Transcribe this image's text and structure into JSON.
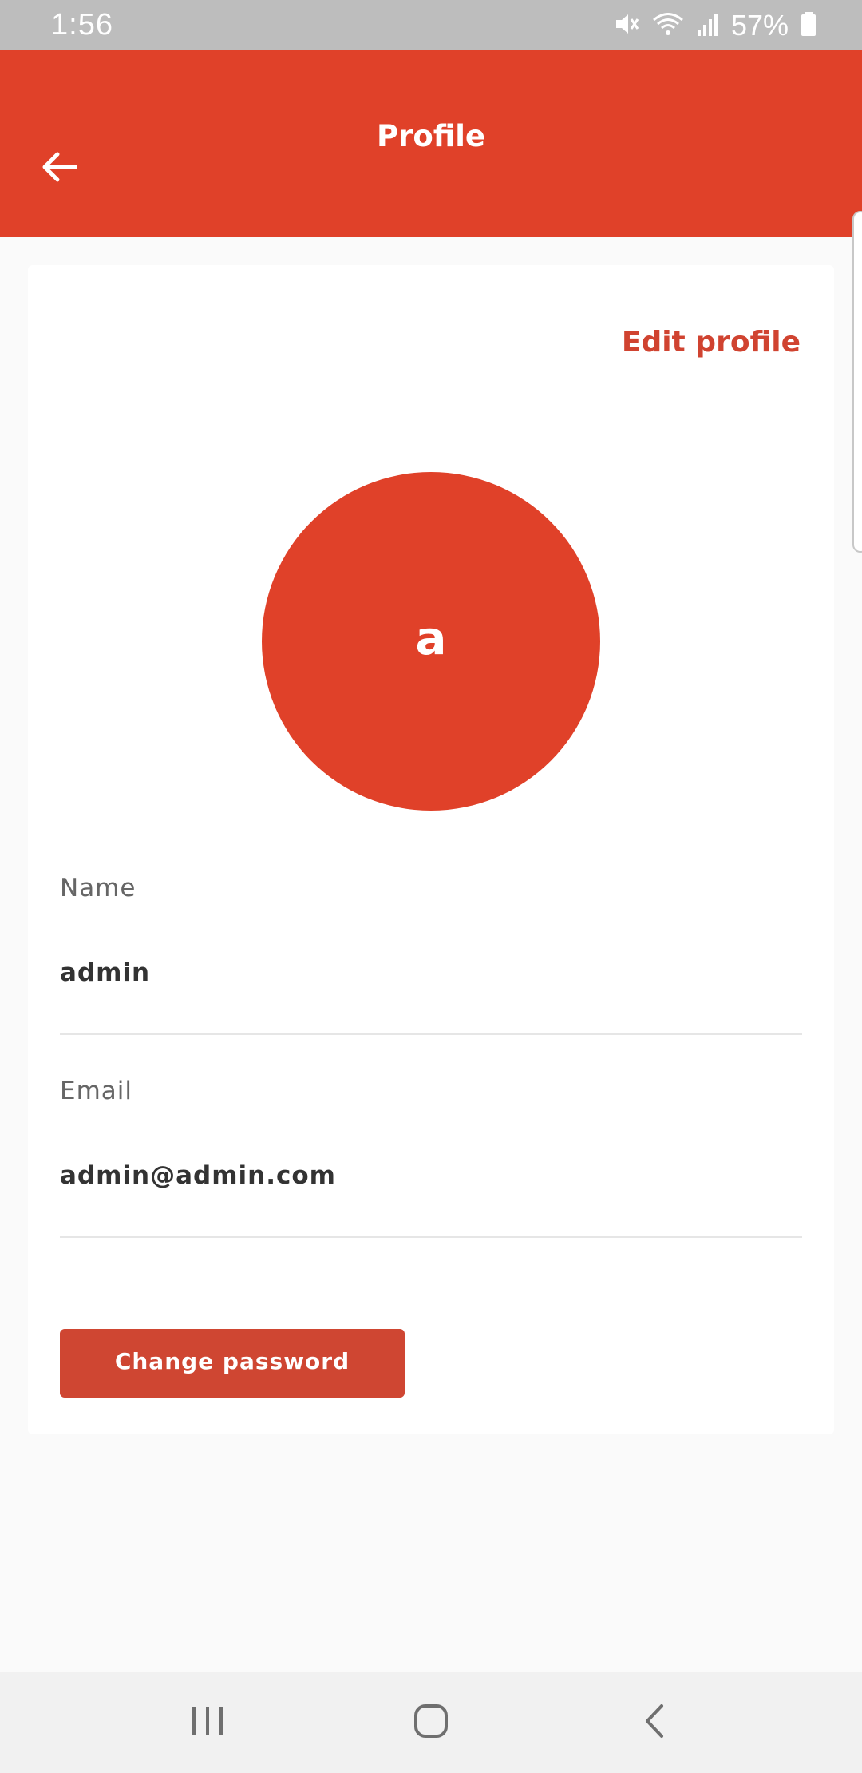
{
  "status_bar": {
    "time": "1:56",
    "battery_text": "57%",
    "icons": [
      "mute-icon",
      "wifi-icon",
      "signal-icon",
      "battery-icon"
    ]
  },
  "app_bar": {
    "title": "Profile",
    "back_icon": "arrow-left-icon",
    "color": "#e04129"
  },
  "profile": {
    "edit_link": "Edit profile",
    "avatar_initial": "a",
    "fields": [
      {
        "label": "Name",
        "value": "admin"
      },
      {
        "label": "Email",
        "value": "admin@admin.com"
      }
    ],
    "change_password_label": "Change password"
  },
  "nav_bar": {
    "buttons": [
      "recents-icon",
      "home-icon",
      "back-icon"
    ]
  },
  "colors": {
    "accent": "#e04129",
    "button": "#cf4632",
    "link": "#d04330",
    "background": "#fafafa"
  }
}
